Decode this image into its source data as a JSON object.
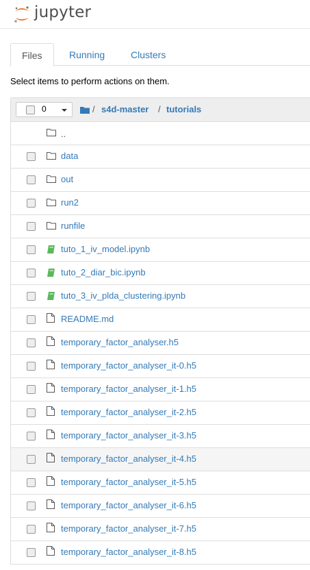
{
  "app": {
    "logo_text": "jupyter",
    "logo_colors": [
      "#f37726",
      "#767677",
      "#9e9e9e"
    ]
  },
  "tabs": [
    {
      "label": "Files",
      "active": true
    },
    {
      "label": "Running",
      "active": false
    },
    {
      "label": "Clusters",
      "active": false
    }
  ],
  "hint": "Select items to perform actions on them.",
  "toolbar": {
    "selected_count": "0",
    "dropdown_icon": "caret-down-icon"
  },
  "breadcrumb": [
    {
      "label": "/",
      "type": "sep"
    },
    {
      "label": "s4d-master",
      "type": "link"
    },
    {
      "label": "/",
      "type": "sep"
    },
    {
      "label": "tutorials",
      "type": "link"
    }
  ],
  "files": [
    {
      "name": "..",
      "type": "parent"
    },
    {
      "name": "data",
      "type": "folder"
    },
    {
      "name": "out",
      "type": "folder"
    },
    {
      "name": "run2",
      "type": "folder"
    },
    {
      "name": "runfile",
      "type": "folder"
    },
    {
      "name": "tuto_1_iv_model.ipynb",
      "type": "notebook"
    },
    {
      "name": "tuto_2_diar_bic.ipynb",
      "type": "notebook"
    },
    {
      "name": "tuto_3_iv_plda_clustering.ipynb",
      "type": "notebook"
    },
    {
      "name": "README.md",
      "type": "file"
    },
    {
      "name": "temporary_factor_analyser.h5",
      "type": "file"
    },
    {
      "name": "temporary_factor_analyser_it-0.h5",
      "type": "file"
    },
    {
      "name": "temporary_factor_analyser_it-1.h5",
      "type": "file"
    },
    {
      "name": "temporary_factor_analyser_it-2.h5",
      "type": "file"
    },
    {
      "name": "temporary_factor_analyser_it-3.h5",
      "type": "file"
    },
    {
      "name": "temporary_factor_analyser_it-4.h5",
      "type": "file",
      "highlighted": true
    },
    {
      "name": "temporary_factor_analyser_it-5.h5",
      "type": "file"
    },
    {
      "name": "temporary_factor_analyser_it-6.h5",
      "type": "file"
    },
    {
      "name": "temporary_factor_analyser_it-7.h5",
      "type": "file"
    },
    {
      "name": "temporary_factor_analyser_it-8.h5",
      "type": "file"
    }
  ],
  "colors": {
    "link": "#337ab7",
    "notebook_icon": "#5cb85c",
    "icon_gray": "#555555"
  }
}
